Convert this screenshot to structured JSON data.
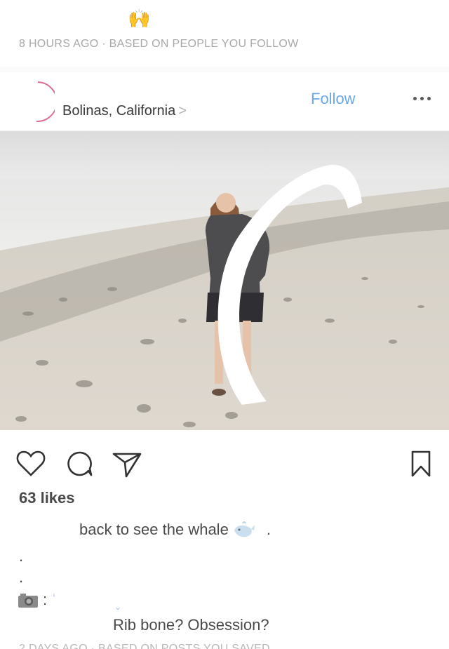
{
  "feed_notice": {
    "emoji_icon": "raising-hands-icon",
    "meta_text": "8 HOURS AGO · BASED ON PEOPLE YOU FOLLOW"
  },
  "post": {
    "location": "Bolinas, California",
    "location_chevron": ">",
    "follow_label": "Follow",
    "more_icon": "more-options-icon",
    "photo_description_icon": "beach-photo",
    "actions": {
      "like_icon": "heart-icon",
      "comment_icon": "comment-icon",
      "share_icon": "send-icon",
      "save_icon": "bookmark-icon"
    },
    "likes": "63 likes",
    "caption_text": "back to see the whale",
    "caption_suffix": ".",
    "dot_1": ".",
    "dot_2": ".",
    "camera_colon": ":",
    "camera_icon": "camera-emoji-icon",
    "reply_text": "Rib bone?  Obsession?"
  },
  "next_notice": {
    "meta_text": "2 DAYS AGO · BASED ON POSTS YOU SAVED"
  },
  "colors": {
    "follow_blue": "#6aa9e6",
    "meta_gray": "#a8a8a8",
    "text_dark": "#4a4a4a"
  }
}
